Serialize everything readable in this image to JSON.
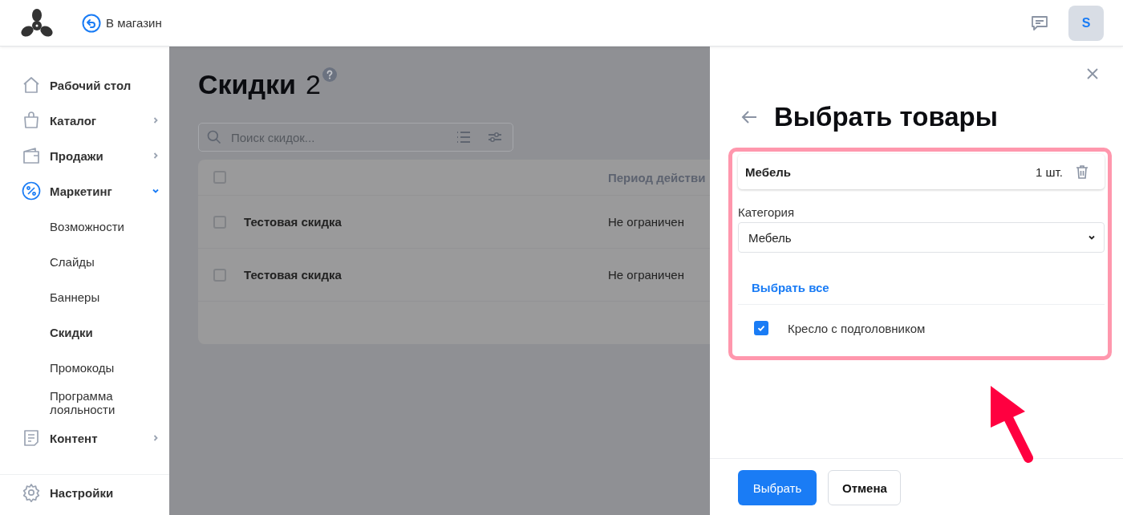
{
  "header": {
    "store_link": "В магазин",
    "avatar": "S"
  },
  "sidebar": {
    "items": [
      {
        "label": "Рабочий стол",
        "selected": false
      },
      {
        "label": "Каталог",
        "selected": false,
        "expanded": false
      },
      {
        "label": "Продажи",
        "selected": false,
        "expanded": false
      },
      {
        "label": "Маркетинг",
        "selected": true,
        "expanded": true,
        "children": [
          {
            "label": "Возможности",
            "selected": false
          },
          {
            "label": "Слайды",
            "selected": false
          },
          {
            "label": "Баннеры",
            "selected": false
          },
          {
            "label": "Скидки",
            "selected": true
          },
          {
            "label": "Промокоды",
            "selected": false
          },
          {
            "label": "Программа лояльности",
            "selected": false
          }
        ]
      },
      {
        "label": "Контент",
        "selected": false,
        "expanded": false
      }
    ],
    "footer_item": "Настройки"
  },
  "page": {
    "title": "Скидки",
    "count": "2",
    "search": {
      "placeholder": "Поиск скидок..."
    },
    "table": {
      "columns": [
        "Период действи"
      ],
      "header_checked": false,
      "rows": [
        {
          "name": "Тестовая скидка",
          "period": "Не ограничен",
          "checked": false
        },
        {
          "name": "Тестовая скидка",
          "period": "Не ограничен",
          "checked": false
        }
      ]
    }
  },
  "panel": {
    "title": "Выбрать товары",
    "group": {
      "name": "Мебель",
      "quantity": "1 шт."
    },
    "category": {
      "label": "Категория",
      "value": "Мебель"
    },
    "select_all": "Выбрать все",
    "products": [
      {
        "name": "Кресло с подголовником",
        "checked": true
      }
    ],
    "buttons": [
      {
        "label": "Выбрать",
        "kind": "primary"
      },
      {
        "label": "Отмена",
        "kind": "secondary"
      }
    ]
  }
}
